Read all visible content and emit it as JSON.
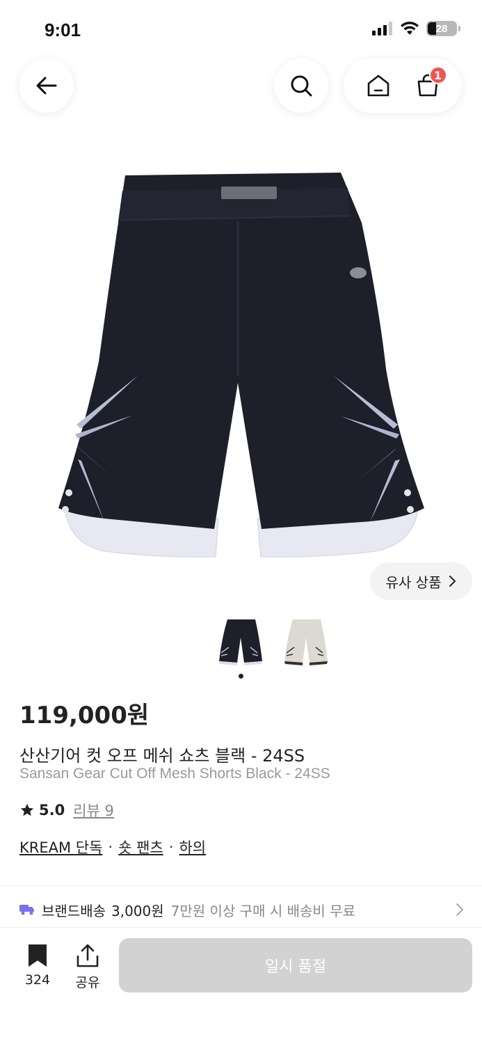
{
  "status_bar": {
    "time": "9:01",
    "battery": "28",
    "icons": [
      "signal-icon",
      "wifi-icon",
      "battery-icon"
    ]
  },
  "nav": {
    "icons": [
      "back-arrow-icon",
      "search-icon",
      "home-icon",
      "shopping-bag-icon"
    ],
    "cart_badge": "1"
  },
  "product": {
    "image_alt": "black mesh shorts",
    "similar_label": "유사 상품",
    "thumbnails": [
      "black",
      "ivory"
    ],
    "price": "119,000원",
    "name_ko": "산산기어 컷 오프 메쉬 쇼츠 블랙 - 24SS",
    "name_en": "Sansan Gear Cut Off Mesh Shorts Black - 24SS",
    "rating": "5.0",
    "review_label": "리뷰 9",
    "tags": [
      "KREAM 단독",
      "숏 팬츠",
      "하의"
    ],
    "tag_separator": "·"
  },
  "shipping": {
    "label": "브랜드배송",
    "price": "3,000원",
    "note": "7만원 이상 구매 시 배송비 무료"
  },
  "bottom_bar": {
    "bookmark_count": "324",
    "share_label": "공유",
    "soldout_label": "일시 품절"
  },
  "colors": {
    "badge": "#f0544f",
    "soldout_bg": "#d2d2d2",
    "shipping_icon": "#7b6ff0"
  }
}
